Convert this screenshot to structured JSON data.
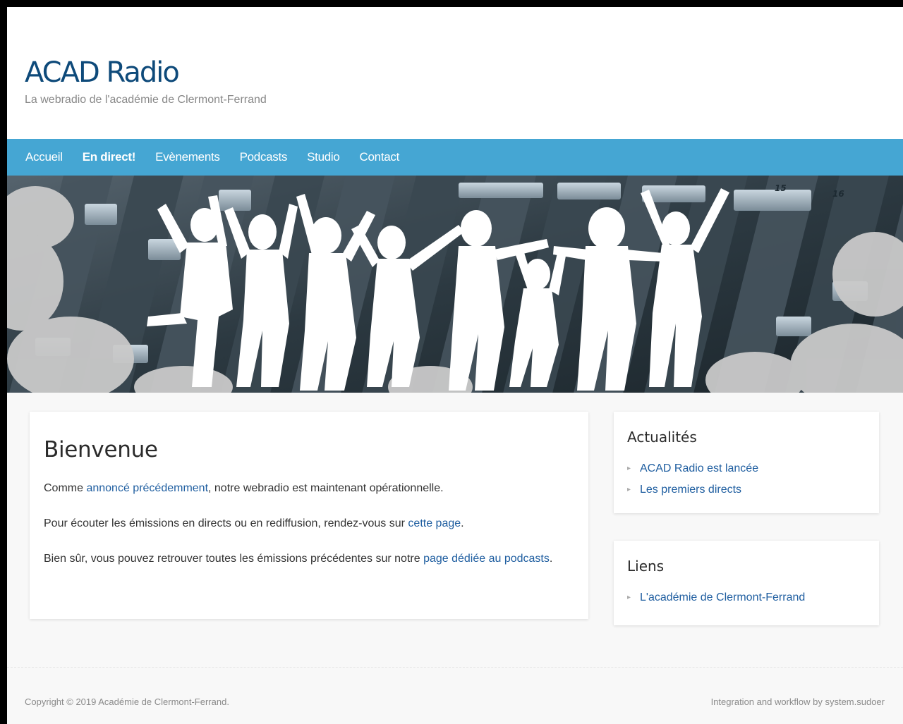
{
  "header": {
    "site_title": "ACAD Radio",
    "tagline": "La webradio de l'académie de Clermont-Ferrand"
  },
  "nav": {
    "items": [
      {
        "label": "Accueil",
        "active": false
      },
      {
        "label": "En direct!",
        "active": true
      },
      {
        "label": "Evènements",
        "active": false
      },
      {
        "label": "Podcasts",
        "active": false
      },
      {
        "label": "Studio",
        "active": false
      },
      {
        "label": "Contact",
        "active": false
      }
    ]
  },
  "main": {
    "title": "Bienvenue",
    "p1": {
      "before": "Comme ",
      "link": "annoncé précédemment",
      "after": ", notre webradio est maintenant opérationnelle."
    },
    "p2": {
      "before": "Pour écouter les émissions en directs ou en rediffusion, rendez-vous sur ",
      "link": "cette page",
      "after": "."
    },
    "p3": {
      "before": "Bien sûr, vous pouvez retrouver toutes les émissions précédentes sur notre ",
      "link": "page dédiée au podcasts",
      "after": "."
    }
  },
  "sidebar": {
    "news": {
      "title": "Actualités",
      "items": [
        "ACAD Radio est lancée",
        "Les premiers directs"
      ]
    },
    "links": {
      "title": "Liens",
      "items": [
        "L'académie de Clermont-Ferrand"
      ]
    }
  },
  "footer": {
    "copyright": "Copyright © 2019 Académie de Clermont-Ferrand.",
    "credit": "Integration and workflow by system.sudoer"
  },
  "colors": {
    "nav_bg": "#45a6d3",
    "title": "#0e4a7a",
    "link": "#1f5ea0"
  }
}
